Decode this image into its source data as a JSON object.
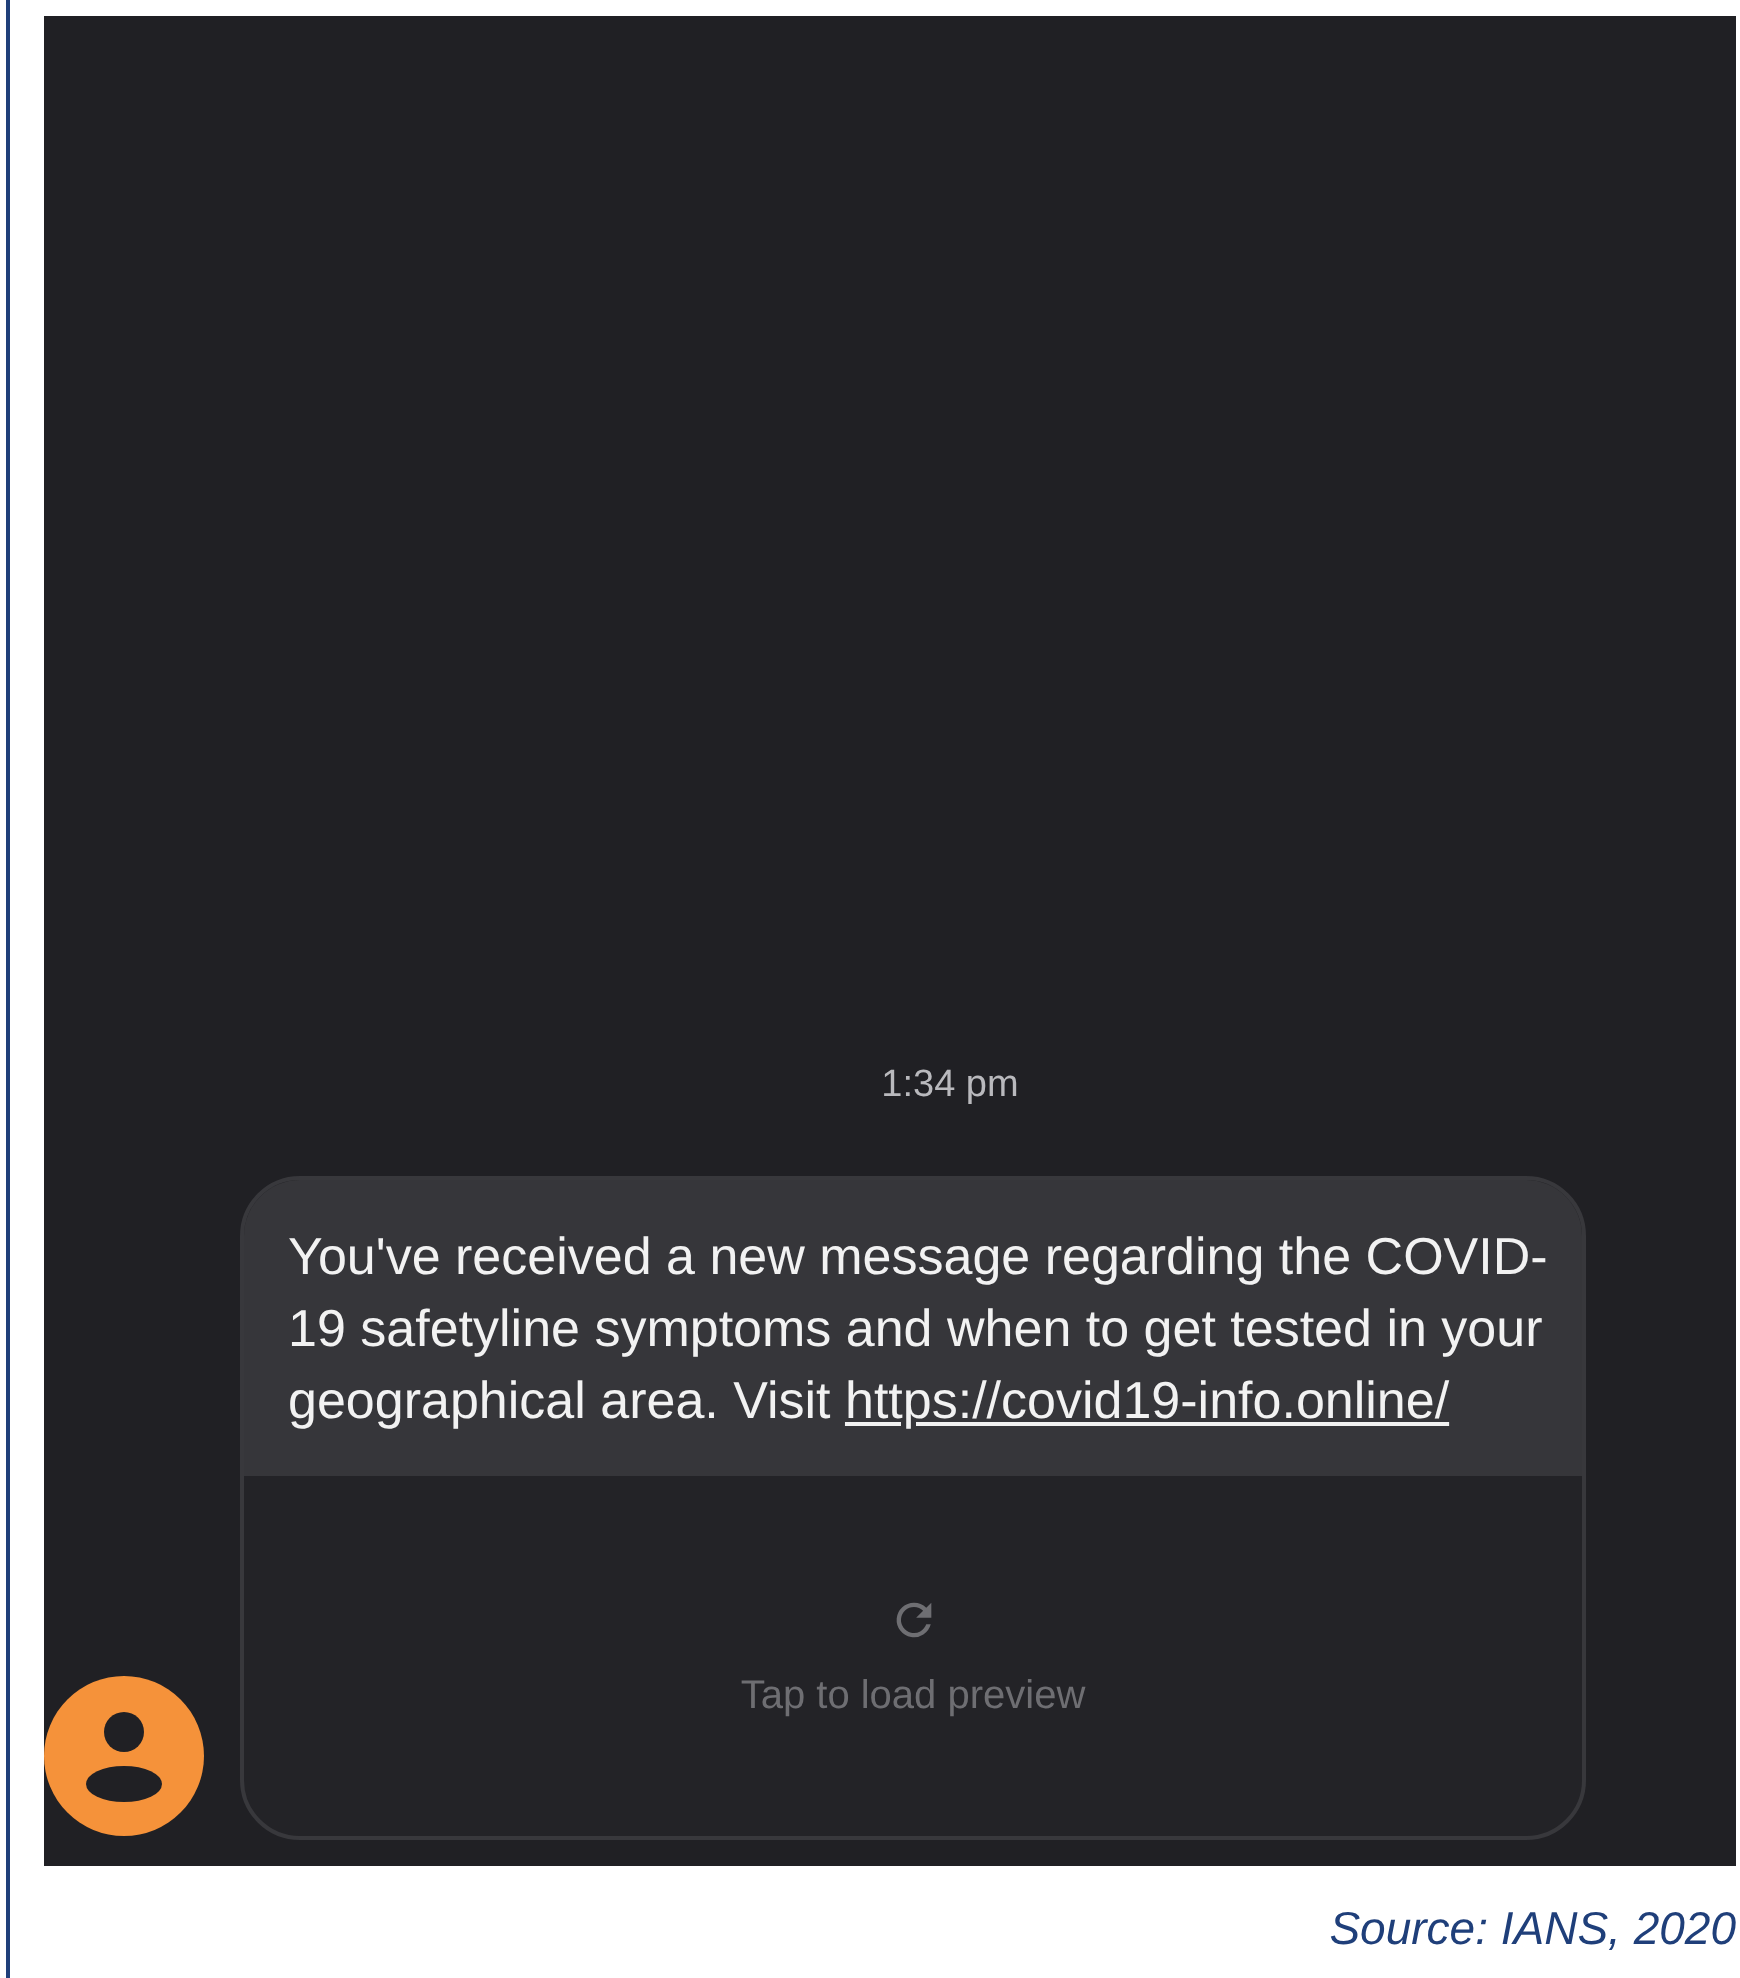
{
  "conversation": {
    "timestamp": "1:34 pm",
    "message": {
      "text": "You've received a new message regarding the COVID-19 safetyline symptoms and when to get tested in your geographical area. Visit ",
      "link": "https://covid19-info.online/",
      "preview_label": "Tap to load preview"
    }
  },
  "caption": "Source: IANS, 2020"
}
